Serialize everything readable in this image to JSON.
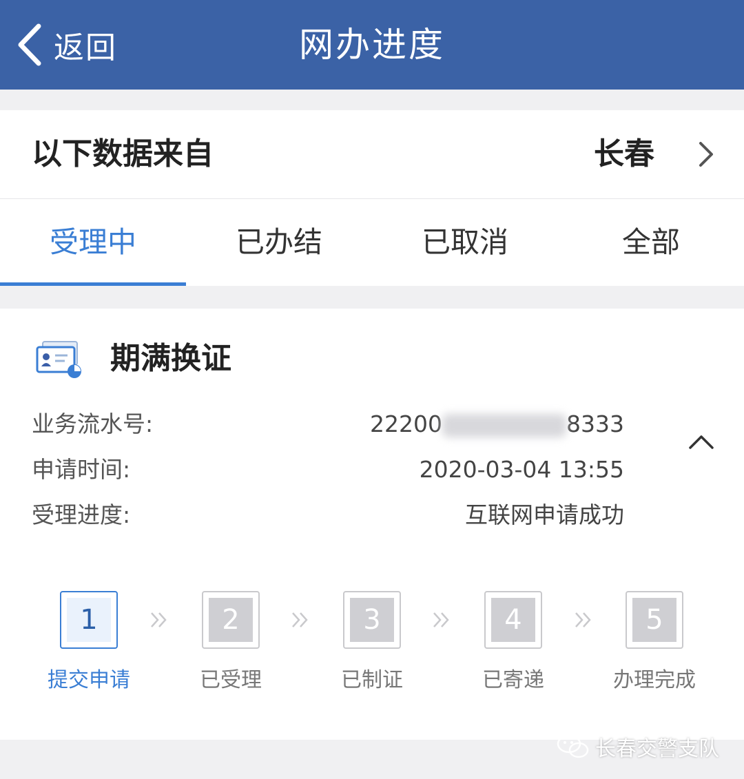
{
  "header": {
    "back_label": "返回",
    "title": "网办进度"
  },
  "source": {
    "label": "以下数据来自",
    "city": "长春"
  },
  "tabs": [
    {
      "label": "受理中",
      "active": true
    },
    {
      "label": "已办结",
      "active": false
    },
    {
      "label": "已取消",
      "active": false
    },
    {
      "label": "全部",
      "active": false
    }
  ],
  "business": {
    "title": "期满换证",
    "serial_label": "业务流水号:",
    "serial_prefix": "22200",
    "serial_suffix": "8333",
    "time_label": "申请时间:",
    "time_value": "2020-03-04 13:55",
    "progress_label": "受理进度:",
    "progress_value": "互联网申请成功"
  },
  "steps": [
    {
      "number": "1",
      "label": "提交申请",
      "active": true
    },
    {
      "number": "2",
      "label": "已受理",
      "active": false
    },
    {
      "number": "3",
      "label": "已制证",
      "active": false
    },
    {
      "number": "4",
      "label": "已寄递",
      "active": false
    },
    {
      "number": "5",
      "label": "办理完成",
      "active": false
    }
  ],
  "watermark": {
    "text": "长春交警支队"
  },
  "colors": {
    "header": "#3b62a6",
    "accent": "#3a7ed4",
    "inactive_step": "#cfcfd3"
  }
}
